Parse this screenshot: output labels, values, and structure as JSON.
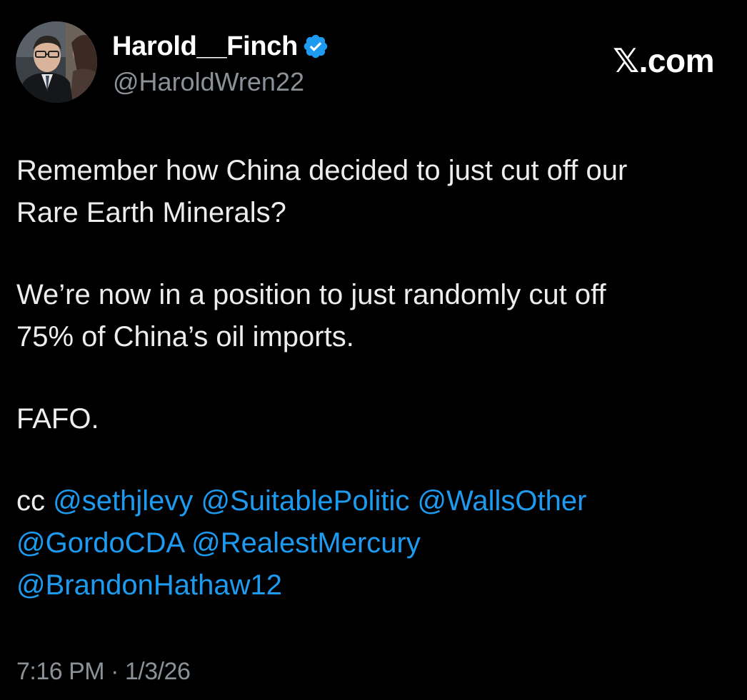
{
  "author": {
    "display_name": "Harold__Finch",
    "handle": "@HaroldWren22",
    "verified": true,
    "avatar_icon": "profile-photo"
  },
  "site_label": {
    "mark": "𝕏",
    "suffix": ".com"
  },
  "tweet": {
    "paragraph_1": "Remember how China decided to just cut off our\nRare Earth Minerals?",
    "paragraph_2": "We’re now in a position to just randomly cut off\n75% of China’s oil imports.",
    "paragraph_3": "FAFO.",
    "cc_prefix": "cc ",
    "mentions": [
      "@sethjlevy",
      "@SuitablePolitic",
      "@WallsOther",
      "@GordoCDA",
      "@RealestMercury",
      "@BrandonHathaw12"
    ]
  },
  "timestamp": "7:16 PM · 1/3/26",
  "colors": {
    "background": "#000000",
    "text": "#e7e9ea",
    "secondary_text": "#8b9197",
    "link": "#1d9bf0",
    "verified_badge": "#1d9bf0"
  }
}
